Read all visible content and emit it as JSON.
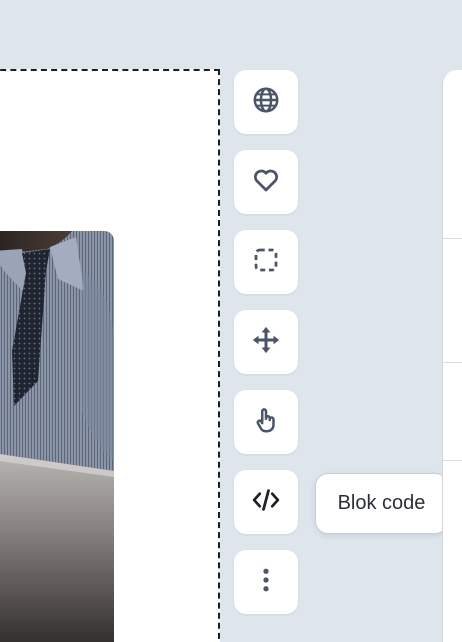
{
  "toolbar": {
    "buttons": [
      {
        "id": "language",
        "icon": "globe-icon"
      },
      {
        "id": "favorite",
        "icon": "heart-icon"
      },
      {
        "id": "select",
        "icon": "dashed-square-select-icon"
      },
      {
        "id": "move",
        "icon": "move-arrows-icon"
      },
      {
        "id": "interact",
        "icon": "hand-pointer-icon"
      },
      {
        "id": "code",
        "icon": "code-brackets-icon"
      },
      {
        "id": "more",
        "icon": "vertical-dots-icon"
      }
    ]
  },
  "tooltip": {
    "text": "Blok code"
  },
  "colors": {
    "background": "#dfe5ec",
    "icon": "#4b5567",
    "code_icon": "#1d2128",
    "button": "#ffffff"
  }
}
